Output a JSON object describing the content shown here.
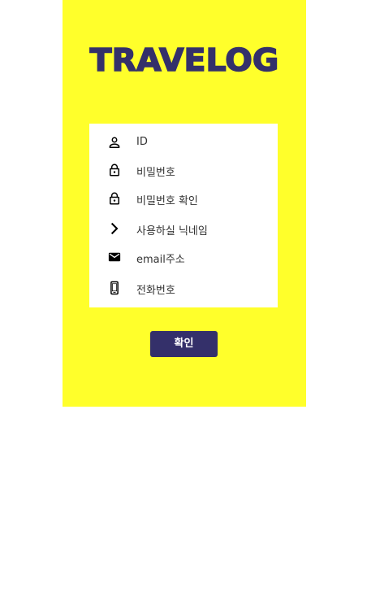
{
  "brand": {
    "logo_text": "TRAVELOG",
    "accent_color": "#ffff2b",
    "brand_color": "#34306a"
  },
  "signup_form": {
    "fields": [
      {
        "icon": "person-icon",
        "placeholder": "ID"
      },
      {
        "icon": "lock-icon",
        "placeholder": "비밀번호"
      },
      {
        "icon": "lock-icon",
        "placeholder": "비밀번호 확인"
      },
      {
        "icon": "chevron-right-icon",
        "placeholder": "사용하실 닉네임"
      },
      {
        "icon": "mail-icon",
        "placeholder": "email주소"
      },
      {
        "icon": "phone-icon",
        "placeholder": "전화번호"
      }
    ],
    "submit_label": "확인"
  }
}
